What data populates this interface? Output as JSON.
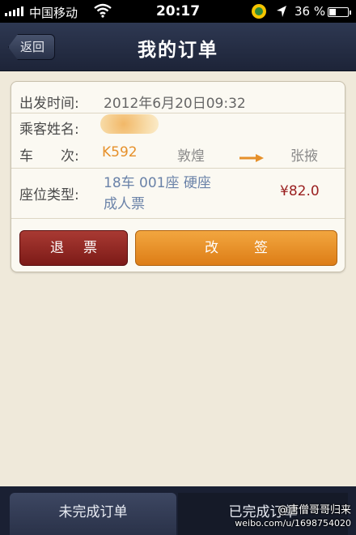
{
  "status_bar": {
    "carrier": "中国移动",
    "time": "20:17",
    "battery_text": "36 %",
    "battery_level": 0.36,
    "icons": [
      "signal-icon",
      "wifi-icon",
      "blackberry-icon",
      "location-icon",
      "battery-icon"
    ]
  },
  "nav": {
    "back_label": "返回",
    "title": "我的订单"
  },
  "order": {
    "depart_label": "出发时间:",
    "depart_value": "2012年6月20日09:32",
    "passenger_label": "乘客姓名:",
    "train_label": "车　　次:",
    "train_no": "K592",
    "from_station": "敦煌",
    "to_station": "张掖",
    "seat_label": "座位类型:",
    "seat_line1": "18车 001座 硬座",
    "seat_line2": "成人票",
    "price": "¥82.0",
    "refund_label": "退票",
    "change_label": "改签"
  },
  "tabs": {
    "incomplete": "未完成订单",
    "complete": "已完成订单"
  },
  "watermark": {
    "handle": "@唐僧哥哥归来",
    "url": "weibo.com/u/1698754020"
  },
  "colors": {
    "nav_bg": "#1d2438",
    "accent_orange": "#e6902a",
    "refund_red": "#8e2a24",
    "change_orange": "#e8901f",
    "price_red": "#9a1f1f",
    "seat_blue": "#6a82a8"
  }
}
